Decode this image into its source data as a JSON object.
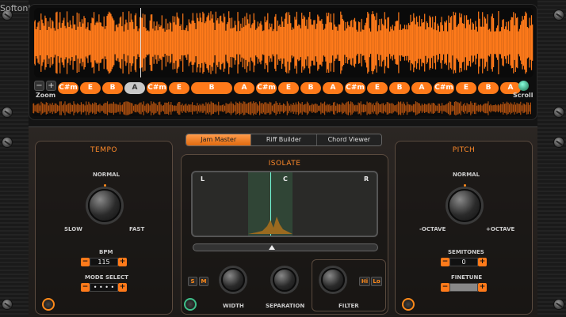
{
  "watermark": "Softonic",
  "timeline": {
    "zoom_label": "Zoom",
    "scroll_label": "Scroll",
    "zoom_minus": "−",
    "zoom_plus": "+",
    "chords": [
      "C#m",
      "E",
      "B",
      "A",
      "C#m",
      "E",
      "B",
      "A",
      "C#m",
      "E",
      "B",
      "A",
      "C#m",
      "E",
      "B",
      "A",
      "C#m",
      "E",
      "B",
      "A"
    ],
    "selected_index": 3
  },
  "tabs": [
    {
      "label": "Jam Master",
      "active": true
    },
    {
      "label": "Riff Builder",
      "active": false
    },
    {
      "label": "Chord Viewer",
      "active": false
    }
  ],
  "tempo": {
    "title": "TEMPO",
    "normal": "NORMAL",
    "slow": "SLOW",
    "fast": "FAST",
    "bpm_label": "BPM",
    "bpm_value": "115",
    "mode_label": "MODE SELECT",
    "mode_value": "• • • •"
  },
  "isolate": {
    "title": "ISOLATE",
    "left": "L",
    "center": "C",
    "right": "R",
    "width_label": "WIDTH",
    "separation_label": "SEPARATION",
    "filter_label": "FILTER",
    "solo": "S",
    "mute": "M",
    "hi": "Hi",
    "lo": "Lo"
  },
  "pitch": {
    "title": "PITCH",
    "normal": "NORMAL",
    "minus_octave": "-OCTAVE",
    "plus_octave": "+OCTAVE",
    "semitones_label": "SEMITONES",
    "semitones_value": "0",
    "finetune_label": "FINETUNE"
  },
  "stepper": {
    "minus": "−",
    "plus": "+"
  },
  "colors": {
    "accent": "#ff7a1a",
    "panel": "#2b2623"
  }
}
